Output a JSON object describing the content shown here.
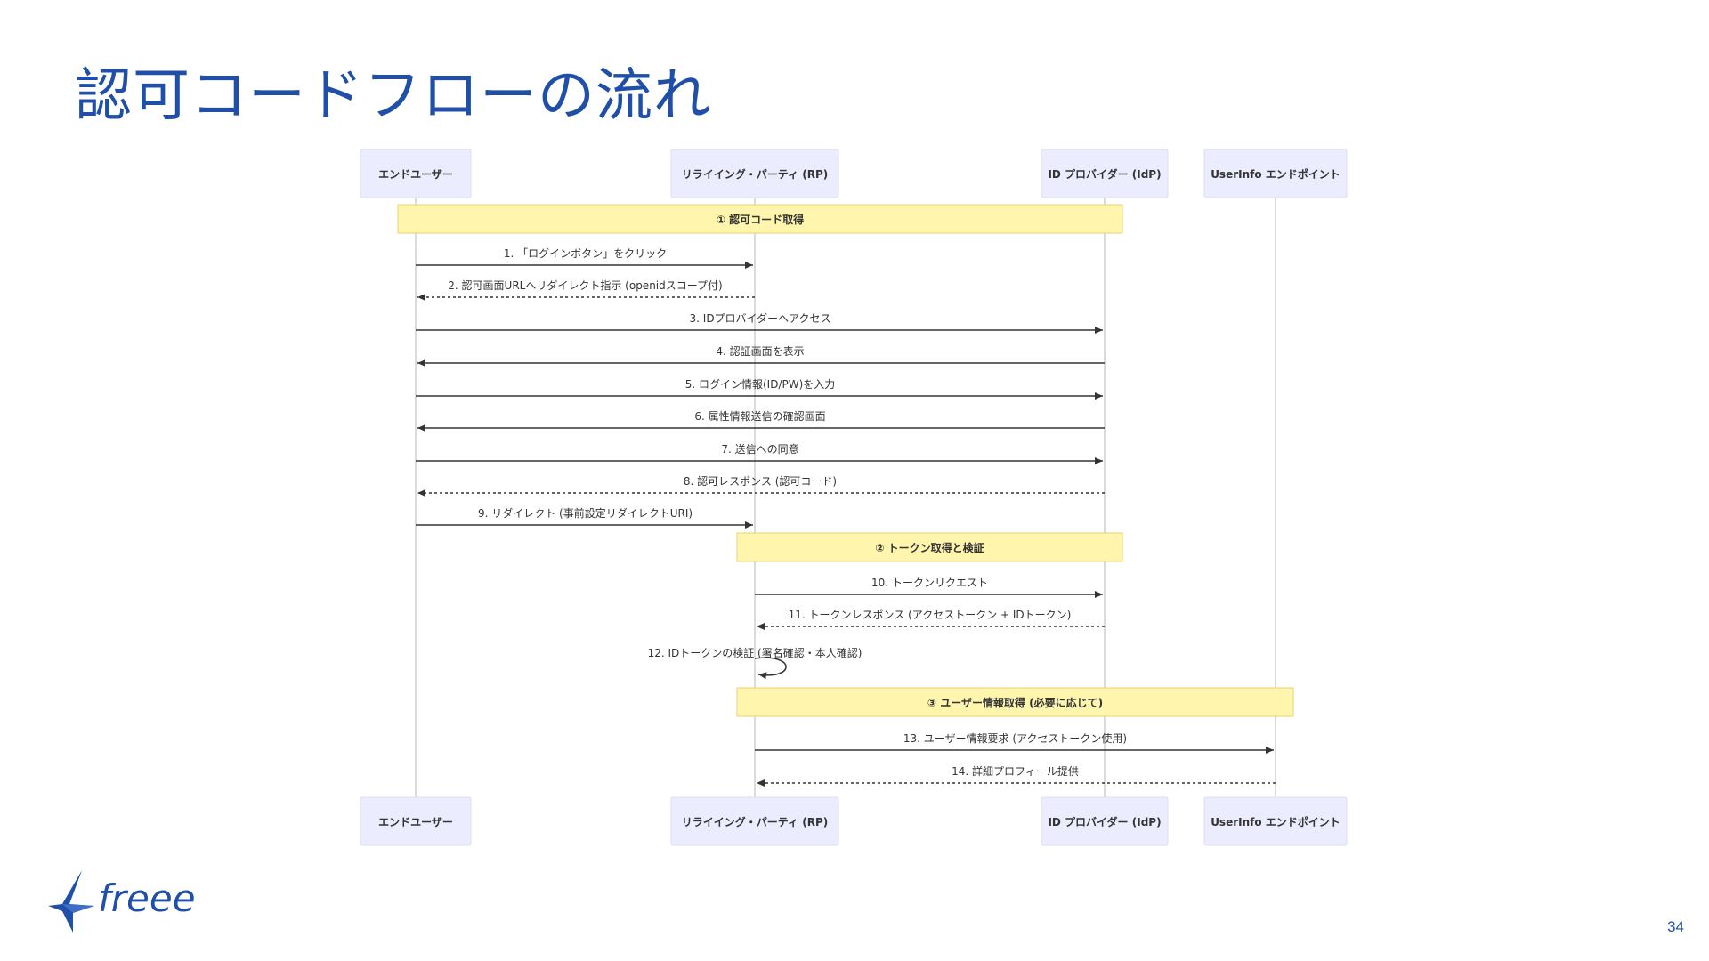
{
  "slide": {
    "title": "認可コードフローの流れ",
    "page_number": "34"
  },
  "logo": {
    "icon": "bird-icon",
    "wordmark": "freee"
  },
  "colors": {
    "title": "#1f4fa8",
    "participant_fill": "#ececff",
    "participant_stroke": "#dcdcf4",
    "note_fill": "#fff5ad",
    "note_stroke": "#e8d470",
    "lifeline": "#cfcfcf",
    "arrow": "#333333"
  },
  "diagram": {
    "participants": [
      "エンドユーザー",
      "リライイング・パーティ (RP)",
      "ID プロバイダー (IdP)",
      "UserInfo エンドポイント"
    ],
    "notes": [
      {
        "text": "① 認可コード取得",
        "from": 0,
        "to": 2
      },
      {
        "text": "② トークン取得と検証",
        "from": 1,
        "to": 2
      },
      {
        "text": "③ ユーザー情報取得 (必要に応じて)",
        "from": 1,
        "to": 3
      }
    ],
    "messages": [
      {
        "text": "1. 「ログインボタン」をクリック",
        "from": 0,
        "to": 1,
        "style": "solid"
      },
      {
        "text": "2. 認可画面URLへリダイレクト指示 (openidスコープ付)",
        "from": 1,
        "to": 0,
        "style": "dashed"
      },
      {
        "text": "3. IDプロバイダーへアクセス",
        "from": 0,
        "to": 2,
        "style": "solid"
      },
      {
        "text": "4. 認証画面を表示",
        "from": 2,
        "to": 0,
        "style": "solid"
      },
      {
        "text": "5. ログイン情報(ID/PW)を入力",
        "from": 0,
        "to": 2,
        "style": "solid"
      },
      {
        "text": "6. 属性情報送信の確認画面",
        "from": 2,
        "to": 0,
        "style": "solid"
      },
      {
        "text": "7. 送信への同意",
        "from": 0,
        "to": 2,
        "style": "solid"
      },
      {
        "text": "8. 認可レスポンス (認可コード)",
        "from": 2,
        "to": 0,
        "style": "dashed"
      },
      {
        "text": "9. リダイレクト (事前設定リダイレクトURI)",
        "from": 0,
        "to": 1,
        "style": "solid"
      },
      {
        "text": "10. トークンリクエスト",
        "from": 1,
        "to": 2,
        "style": "solid"
      },
      {
        "text": "11. トークンレスポンス (アクセストークン + IDトークン)",
        "from": 2,
        "to": 1,
        "style": "dashed"
      },
      {
        "text": "12. IDトークンの検証 (署名確認・本人確認)",
        "from": 1,
        "to": 1,
        "style": "self"
      },
      {
        "text": "13. ユーザー情報要求 (アクセストークン使用)",
        "from": 1,
        "to": 3,
        "style": "solid"
      },
      {
        "text": "14. 詳細プロフィール提供",
        "from": 3,
        "to": 1,
        "style": "dashed"
      }
    ]
  }
}
